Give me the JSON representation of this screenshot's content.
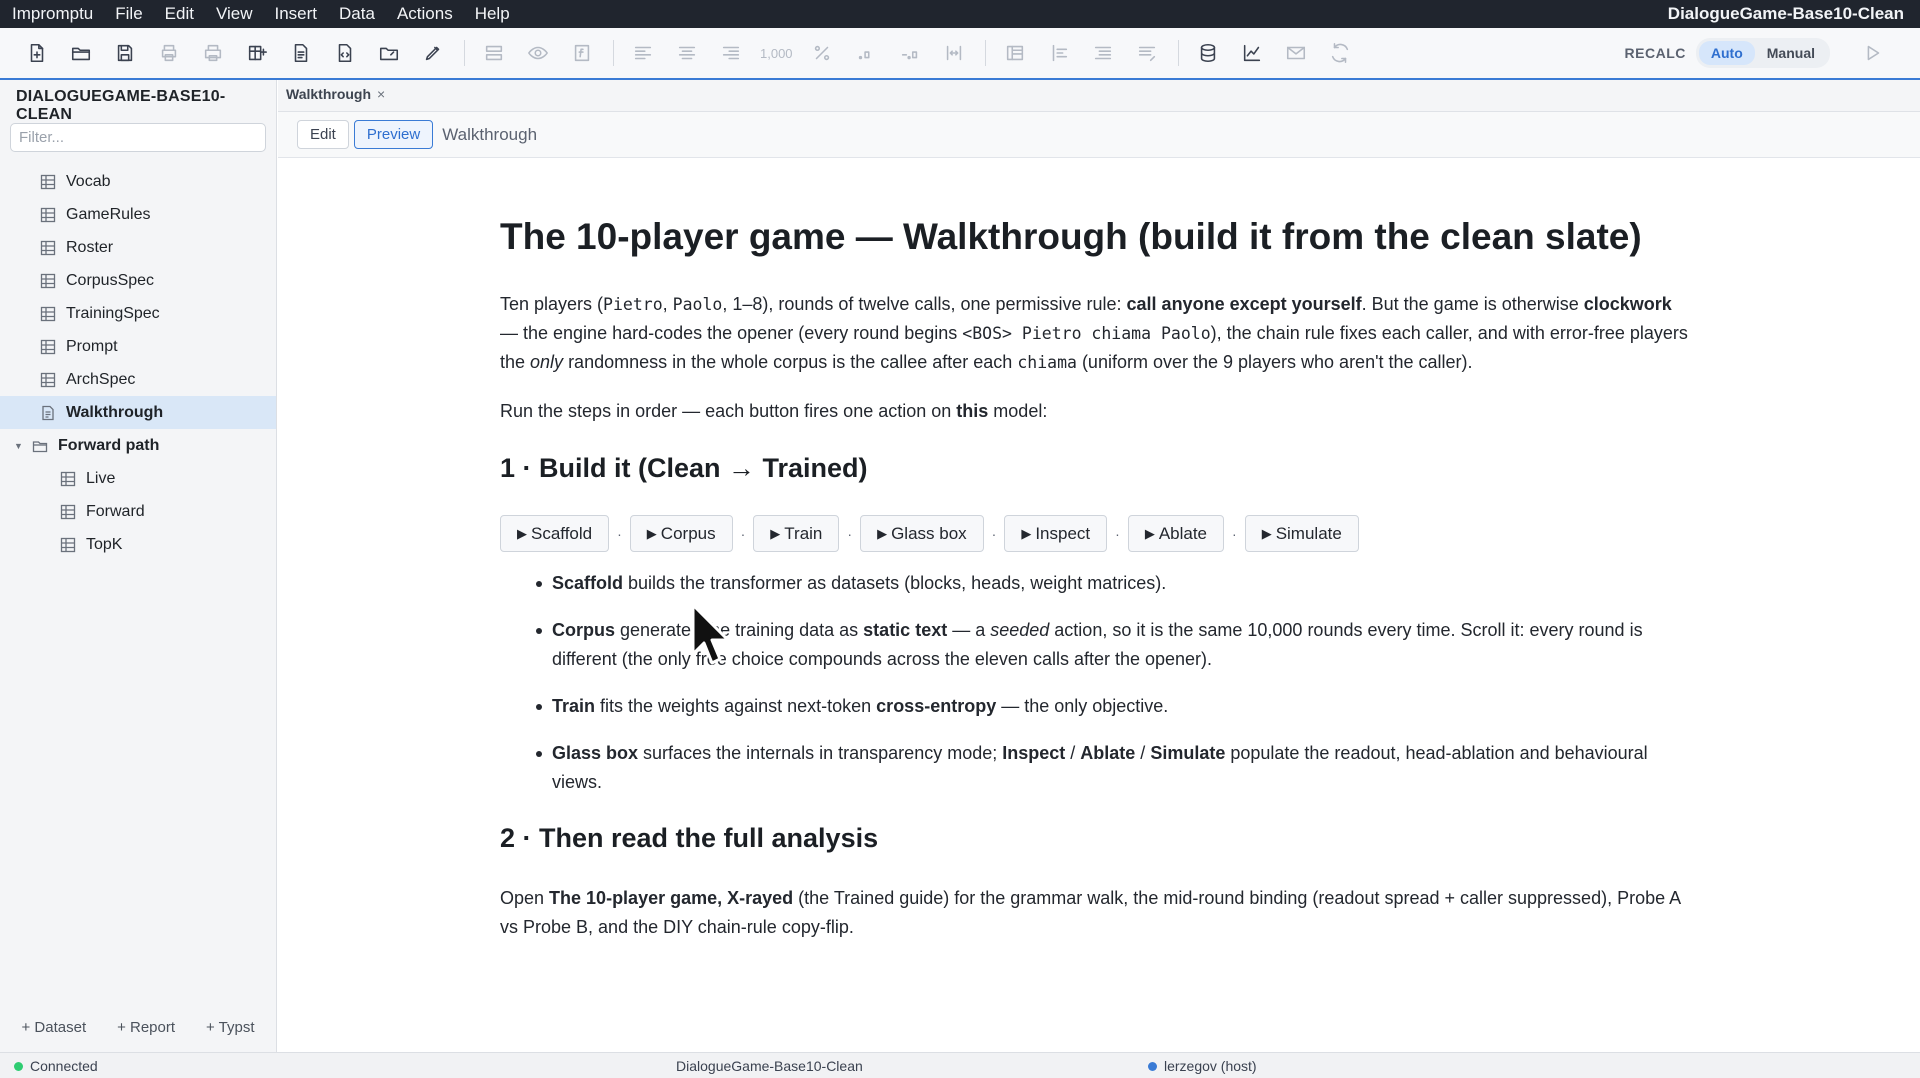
{
  "menubar": {
    "items": [
      "Impromptu",
      "File",
      "Edit",
      "View",
      "Insert",
      "Data",
      "Actions",
      "Help"
    ],
    "app_title": "DialogueGame-Base10-Clean"
  },
  "toolbar": {
    "number_format_label": "1,000",
    "recalc_label": "RECALC",
    "recalc_mode": {
      "auto": "Auto",
      "manual": "Manual",
      "selected": "Auto"
    },
    "accent_color": "#3a7bd5"
  },
  "sidebar": {
    "project_title": "DIALOGUEGAME-BASE10-CLEAN",
    "filter_placeholder": "Filter...",
    "items": [
      {
        "label": "Vocab",
        "icon": "table-icon"
      },
      {
        "label": "GameRules",
        "icon": "table-icon"
      },
      {
        "label": "Roster",
        "icon": "table-icon"
      },
      {
        "label": "CorpusSpec",
        "icon": "table-icon"
      },
      {
        "label": "TrainingSpec",
        "icon": "table-icon"
      },
      {
        "label": "Prompt",
        "icon": "table-icon"
      },
      {
        "label": "ArchSpec",
        "icon": "table-icon"
      },
      {
        "label": "Walkthrough",
        "icon": "document-icon",
        "selected": true
      },
      {
        "label": "Forward path",
        "icon": "folder-icon",
        "expanded": true
      },
      {
        "label": "Live",
        "icon": "table-icon"
      },
      {
        "label": "Forward",
        "icon": "table-icon"
      },
      {
        "label": "TopK",
        "icon": "table-icon"
      }
    ],
    "footer": {
      "add_dataset": "+ Dataset",
      "add_report": "+ Report",
      "add_typst": "+ Typst"
    }
  },
  "tabs": [
    {
      "label": "Walkthrough",
      "close": "×"
    }
  ],
  "doc_header": {
    "edit_label": "Edit",
    "preview_label": "Preview",
    "mode_selected": "Preview",
    "breadcrumb": "Walkthrough"
  },
  "document": {
    "title": "The 10-player game — Walkthrough (build it from the clean slate)",
    "intro": {
      "t1": "Ten players (",
      "c1": "Pietro",
      "t2": ", ",
      "c2": "Paolo",
      "t3": ", 1–8), rounds of twelve calls, one permissive rule: ",
      "b1": "call anyone except yourself",
      "t4": ". But the game is otherwise ",
      "b2": "clockwork",
      "t5": " — the engine hard-codes the opener (every round begins ",
      "c3": "<BOS> Pietro chiama Paolo",
      "t6": "), the chain rule fixes each caller, and with error-free players the ",
      "i1": "only",
      "t7": " randomness in the whole corpus is the callee after each ",
      "c4": "chiama",
      "t8": " (uniform over the 9 players who aren't the caller)."
    },
    "run_line": {
      "t1": "Run the steps in order — each button fires one action on ",
      "b1": "this",
      "t2": " model:"
    },
    "section1_title": "1 · Build it (Clean → Trained)",
    "action_buttons": [
      "Scaffold",
      "Corpus",
      "Train",
      "Glass box",
      "Inspect",
      "Ablate",
      "Simulate"
    ],
    "action_separator": "·",
    "action_glyph": "▶",
    "bullets": {
      "scaffold": {
        "b1": "Scaffold",
        "t1": " builds the transformer as datasets (blocks, heads, weight matrices)."
      },
      "corpus": {
        "b1": "Corpus",
        "t1": " generates the training data as ",
        "b2": "static text",
        "t2": " — a ",
        "i1": "seeded",
        "t3": " action, so it is the same 10,000 rounds every time. Scroll it: every round is different (the only free choice compounds across the eleven calls after the opener)."
      },
      "train": {
        "b1": "Train",
        "t1": " fits the weights against next-token ",
        "b2": "cross-entropy",
        "t2": " — the only objective."
      },
      "glassbox": {
        "b1": "Glass box",
        "t1": " surfaces the internals in transparency mode; ",
        "b2": "Inspect",
        "t2": " / ",
        "b3": "Ablate",
        "t3": " / ",
        "b4": "Simulate",
        "t4": " populate the readout, head-ablation and behavioural views."
      }
    },
    "section2_title": "2 · Then read the full analysis",
    "open_line": {
      "t1": "Open ",
      "b1": "The 10-player game, X-rayed",
      "t2": " (the Trained guide) for the grammar walk, the mid-round binding (readout spread + caller suppressed), Probe A vs Probe B, and the DIY chain-rule copy-flip."
    }
  },
  "statusbar": {
    "connection": "Connected",
    "connection_color": "#2ecc71",
    "file": "DialogueGame-Base10-Clean",
    "user": "lerzegov (host)",
    "user_color": "#3a7bd5"
  }
}
